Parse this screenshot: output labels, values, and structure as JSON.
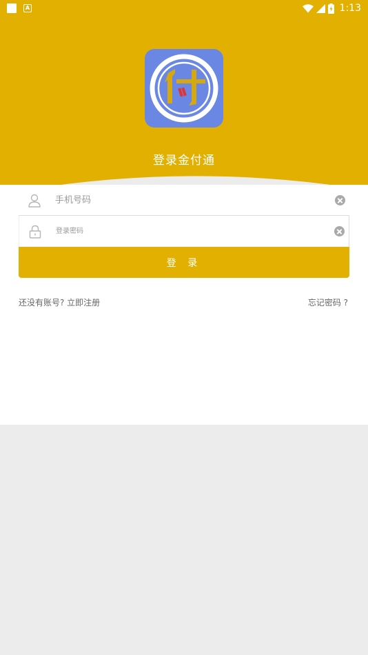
{
  "status_bar": {
    "time": "1:13",
    "icons": [
      "notification-square-icon",
      "notification-a-icon",
      "wifi-icon",
      "signal-icon",
      "battery-charging-icon"
    ]
  },
  "colors": {
    "header": "#e2b000",
    "logo_bg": "#6a87e3",
    "button": "#e2b000",
    "page_bg": "#ececec"
  },
  "app": {
    "title": "登录金付通",
    "logo_glyph": "付"
  },
  "form": {
    "phone_placeholder": "手机号码",
    "phone_value": "",
    "password_placeholder": "登录密码",
    "password_value": "",
    "submit_label": "登 录"
  },
  "links": {
    "register": "还没有账号? 立即注册",
    "forgot": "忘记密码 ?"
  }
}
